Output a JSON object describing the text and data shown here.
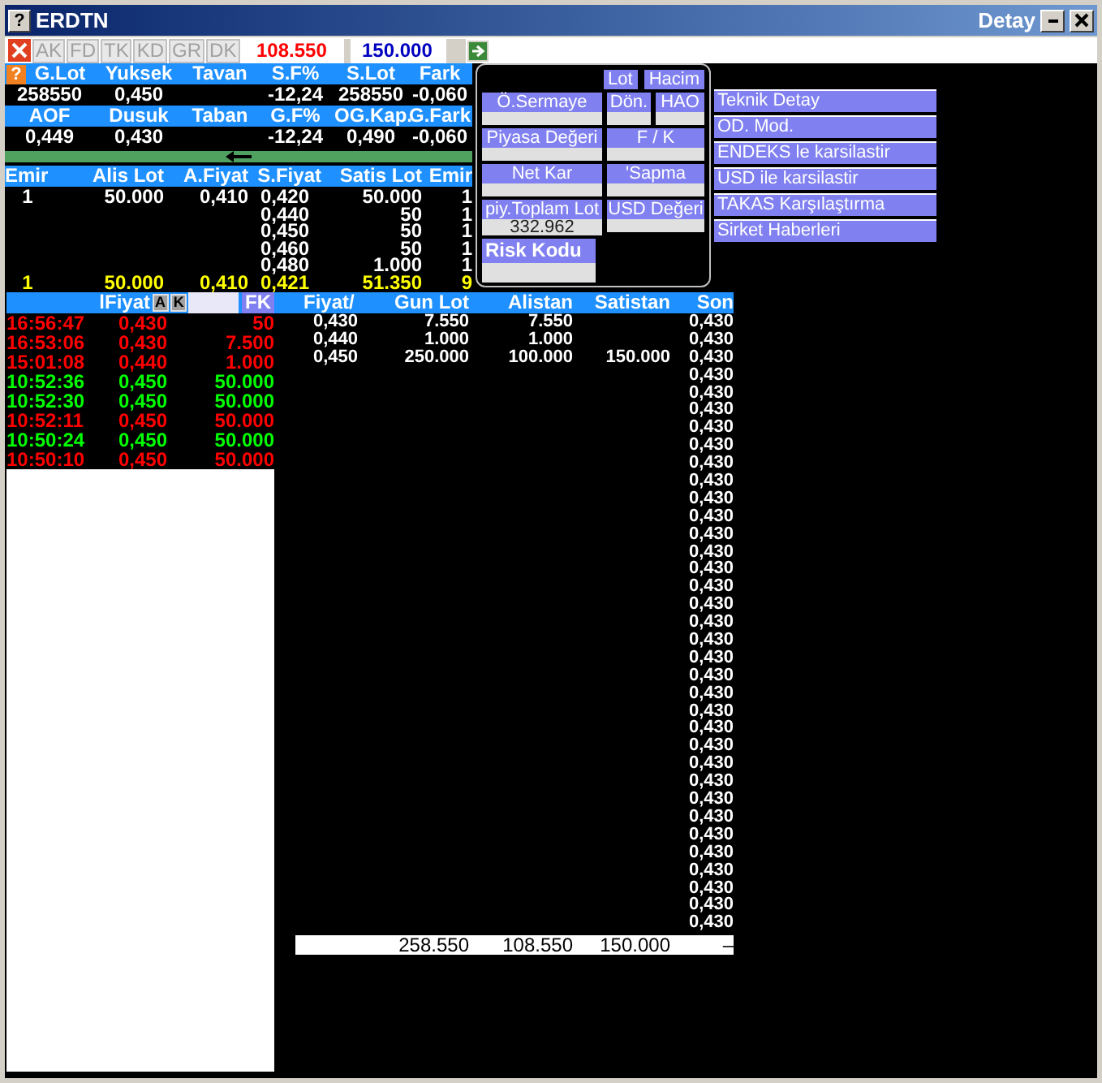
{
  "window": {
    "help": "?",
    "title": "ERDTN",
    "subtitle": "Detay"
  },
  "toolbar": {
    "buttons": [
      "AK",
      "FD",
      "TK",
      "KD",
      "GR",
      "DK"
    ],
    "fields": [
      {
        "value": "108.550",
        "color": "#ff0000"
      },
      {
        "value": "150.000",
        "color": "#0000c0"
      }
    ]
  },
  "summary": {
    "help": "?",
    "rows": [
      {
        "kind": "header",
        "cells": [
          "G.Lot",
          "Yuksek",
          "Tavan",
          "S.F%",
          "S.Lot",
          "Fark"
        ]
      },
      {
        "kind": "values",
        "cells": [
          "258550",
          "0,450",
          "",
          "-12,24",
          "258550",
          "-0,060"
        ]
      },
      {
        "kind": "header",
        "cells": [
          "AOF",
          "Dusuk",
          "Taban",
          "G.F%",
          "OG.Kap.",
          "G.Fark"
        ]
      },
      {
        "kind": "values",
        "cells": [
          "0,449",
          "0,430",
          "",
          "-12,24",
          "0,490",
          "-0,060"
        ]
      }
    ]
  },
  "depth": {
    "columns": [
      "Emir",
      "Alis Lot",
      "A.Fiyat",
      "S.Fiyat",
      "Satis Lot",
      "Emir"
    ],
    "rows": [
      {
        "kind": "order",
        "cells": [
          "1",
          "50.000",
          "0,410",
          "0,420",
          "50.000",
          "1"
        ]
      },
      {
        "kind": "order",
        "cells": [
          "",
          "",
          "",
          "0,440",
          "50",
          "1"
        ]
      },
      {
        "kind": "order",
        "cells": [
          "",
          "",
          "",
          "0,450",
          "50",
          "1"
        ]
      },
      {
        "kind": "order",
        "cells": [
          "",
          "",
          "",
          "0,460",
          "50",
          "1"
        ]
      },
      {
        "kind": "order",
        "cells": [
          "",
          "",
          "",
          "0,480",
          "1.000",
          "1"
        ]
      },
      {
        "kind": "total",
        "cells": [
          "1",
          "50.000",
          "0,410",
          "0,421",
          "51.350",
          "9"
        ]
      }
    ]
  },
  "info_panel": {
    "toggles": [
      "Lot",
      "Hacim"
    ],
    "rows": [
      [
        {
          "label": "Ö.Sermaye"
        },
        {
          "label": "Dön."
        },
        {
          "label": "HAO"
        }
      ],
      [
        {
          "label": "Piyasa Değeri"
        },
        {
          "label": "F / K"
        }
      ],
      [
        {
          "label": "Net Kar"
        },
        {
          "label": "'Sapma"
        }
      ],
      [
        {
          "label": "piy.Toplam Lot",
          "value": "332.962"
        },
        {
          "label": "USD Değeri"
        }
      ],
      [
        {
          "label": "Risk Kodu",
          "kind": "large"
        }
      ]
    ]
  },
  "menu": [
    "Teknik Detay",
    "OD. Mod.",
    "ENDEKS le karsilastir",
    "USD ile karsilastir",
    "TAKAS Karşılaştırma",
    "Sirket Haberleri"
  ],
  "trades": {
    "label": "lFiyat",
    "buttons": [
      "A",
      "K"
    ],
    "filter_button": "FK",
    "rows": [
      {
        "time": "16:56:47",
        "price": "0,430",
        "lot": "50",
        "color": "#ff0000"
      },
      {
        "time": "16:53:06",
        "price": "0,430",
        "lot": "7.500",
        "color": "#ff0000"
      },
      {
        "time": "15:01:08",
        "price": "0,440",
        "lot": "1.000",
        "color": "#ff0000"
      },
      {
        "time": "10:52:36",
        "price": "0,450",
        "lot": "50.000",
        "color": "#00ff00"
      },
      {
        "time": "10:52:30",
        "price": "0,450",
        "lot": "50.000",
        "color": "#00ff00"
      },
      {
        "time": "10:52:11",
        "price": "0,450",
        "lot": "50.000",
        "color": "#ff0000"
      },
      {
        "time": "10:50:24",
        "price": "0,450",
        "lot": "50.000",
        "color": "#00ff00"
      },
      {
        "time": "10:50:10",
        "price": "0,450",
        "lot": "50.000",
        "color": "#ff0000"
      }
    ]
  },
  "price_table": {
    "columns": [
      "Fiyat/",
      "Gun Lot",
      "Alistan",
      "Satistan",
      "Son"
    ],
    "rows": [
      {
        "fiyat": "0,430",
        "gun_lot": "7.550",
        "alistan": "7.550",
        "son": "0,430"
      },
      {
        "fiyat": "0,440",
        "gun_lot": "1.000",
        "alistan": "1.000",
        "son": "0,430"
      },
      {
        "fiyat": "0,450",
        "gun_lot": "250.000",
        "alistan": "100.000",
        "satistan": "150.000",
        "son": "0,430"
      },
      {
        "son": "0,430"
      },
      {
        "son": "0,430"
      },
      {
        "son": "0,430"
      },
      {
        "son": "0,430"
      },
      {
        "son": "0,430"
      },
      {
        "son": "0,430"
      },
      {
        "son": "0,430"
      },
      {
        "son": "0,430"
      },
      {
        "son": "0,430"
      },
      {
        "son": "0,430"
      },
      {
        "son": "0,430"
      },
      {
        "son": "0,430"
      },
      {
        "son": "0,430"
      },
      {
        "son": "0,430"
      },
      {
        "son": "0,430"
      },
      {
        "son": "0,430"
      },
      {
        "son": "0,430"
      },
      {
        "son": "0,430"
      },
      {
        "son": "0,430"
      },
      {
        "son": "0,430"
      },
      {
        "son": "0,430"
      },
      {
        "son": "0,430"
      },
      {
        "son": "0,430"
      },
      {
        "son": "0,430"
      },
      {
        "son": "0,430"
      },
      {
        "son": "0,430"
      },
      {
        "son": "0,430"
      },
      {
        "son": "0,430"
      },
      {
        "son": "0,430"
      },
      {
        "son": "0,430"
      },
      {
        "son": "0,430"
      },
      {
        "son": "0,430"
      }
    ],
    "total": {
      "gun_lot": "258.550",
      "alistan": "108.550",
      "satistan": "150.000",
      "son": "–"
    }
  }
}
